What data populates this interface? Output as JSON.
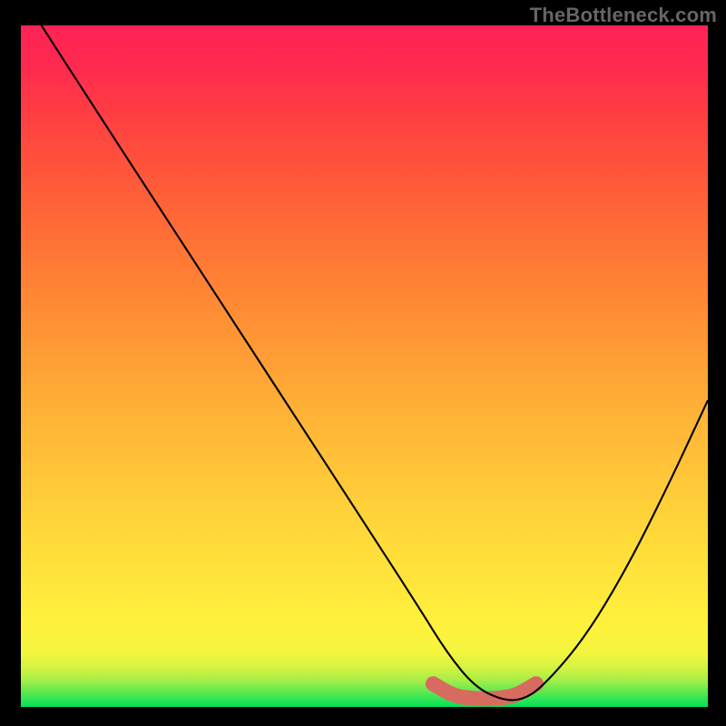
{
  "watermark": "TheBottleneck.com",
  "chart_data": {
    "type": "line",
    "title": "",
    "xlabel": "",
    "ylabel": "",
    "xlim": [
      0,
      100
    ],
    "ylim": [
      0,
      100
    ],
    "grid": false,
    "legend": false,
    "series": [
      {
        "name": "bottleneck-curve",
        "color": "#000000",
        "x": [
          3,
          10,
          20,
          30,
          40,
          50,
          58,
          62,
          66,
          70,
          73,
          76,
          82,
          88,
          94,
          100
        ],
        "y": [
          100,
          89,
          73.5,
          58,
          42.5,
          27,
          14.5,
          8,
          3,
          1,
          1,
          3,
          10,
          20,
          32,
          45
        ]
      }
    ],
    "marker": {
      "name": "optimal-range",
      "color": "#d86b60",
      "x": [
        60,
        63,
        66,
        69,
        72,
        75
      ],
      "y": [
        3.4,
        1.6,
        1.2,
        1.2,
        1.6,
        3.4
      ]
    },
    "gradient_scale": {
      "description": "bottleneck-percent-color",
      "stops": [
        {
          "pct": 0,
          "color": "#00e05a"
        },
        {
          "pct": 10,
          "color": "#d8f441"
        },
        {
          "pct": 25,
          "color": "#ffd93a"
        },
        {
          "pct": 50,
          "color": "#ffa636"
        },
        {
          "pct": 75,
          "color": "#ff5a39"
        },
        {
          "pct": 100,
          "color": "#ff2356"
        }
      ]
    }
  }
}
